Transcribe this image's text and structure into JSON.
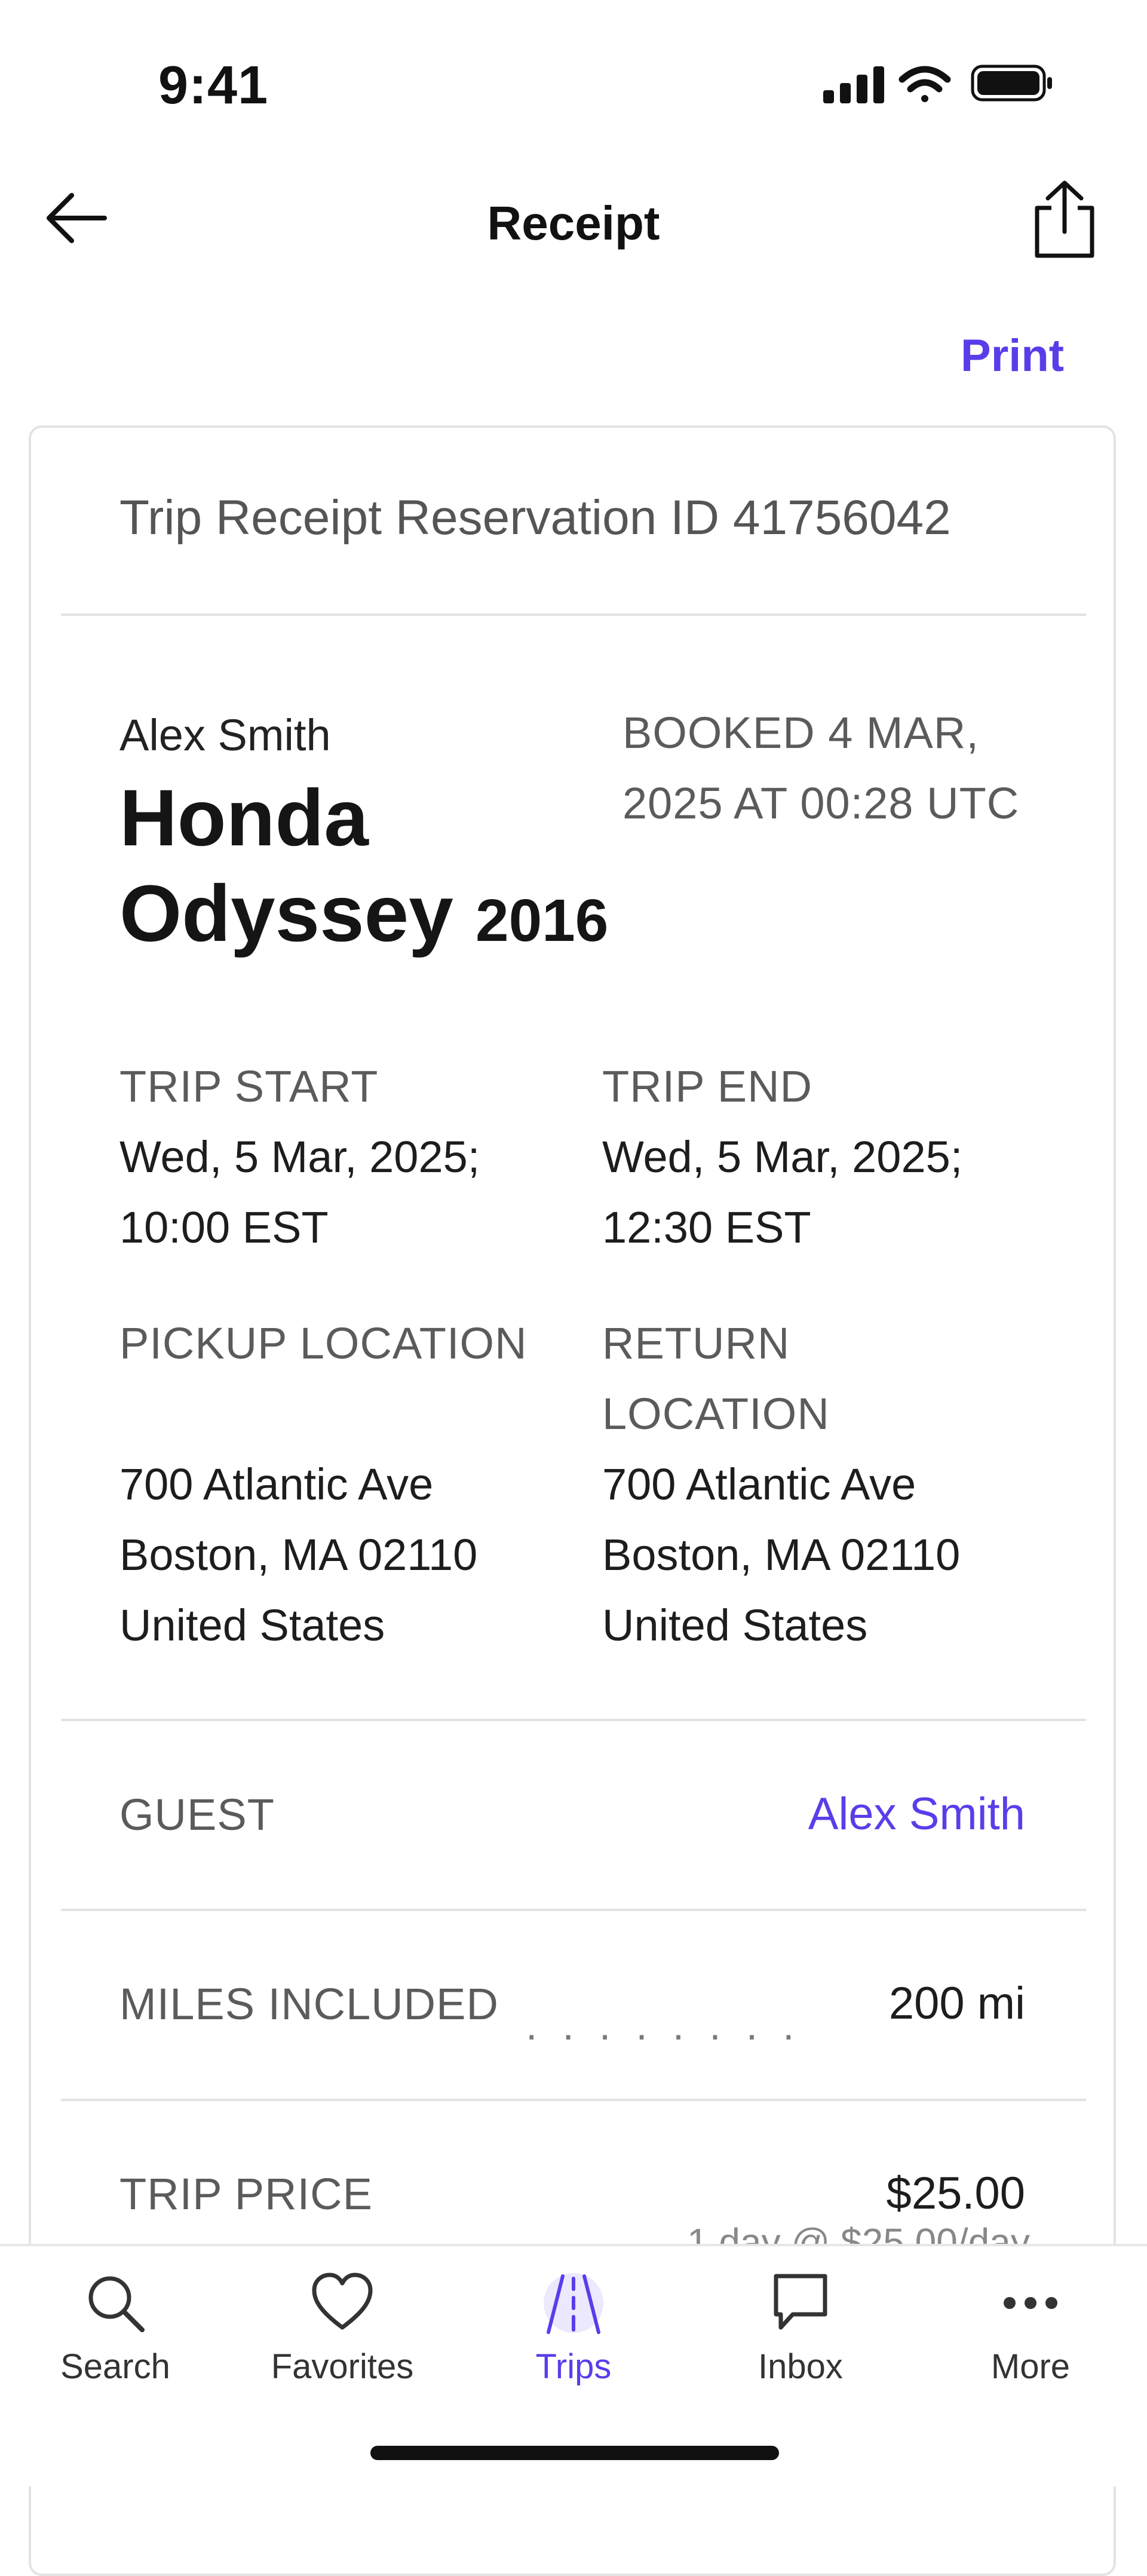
{
  "status_bar": {
    "time": "9:41"
  },
  "header": {
    "title": "Receipt",
    "print_label": "Print"
  },
  "receipt": {
    "heading": "Trip Receipt Reservation ID 41756042",
    "owner_name": "Alex Smith",
    "car_name": "Honda Odyssey",
    "car_year": "2016",
    "booked": "BOOKED 4 MAR, 2025 AT 00:28 UTC",
    "trip_start": {
      "label": "TRIP START",
      "value": "Wed, 5 Mar, 2025; 10:00 EST"
    },
    "trip_end": {
      "label": "TRIP END",
      "value": "Wed, 5 Mar, 2025; 12:30 EST"
    },
    "pickup": {
      "label": "PICKUP LOCATION",
      "line1": "700 Atlantic Ave",
      "line2": "Boston, MA 02110",
      "line3": "United States"
    },
    "return": {
      "label": "RETURN LOCATION",
      "line1": "700 Atlantic Ave",
      "line2": "Boston, MA 02110",
      "line3": "United States"
    },
    "guest": {
      "label": "GUEST",
      "value": "Alex Smith"
    },
    "miles": {
      "label": "MILES INCLUDED",
      "value": "200 mi"
    },
    "trip_price": {
      "label": "TRIP PRICE",
      "value": "$25.00",
      "detail": "1 day @ $25.00/day"
    }
  },
  "tabs": [
    {
      "label": "Search",
      "icon": "search-icon"
    },
    {
      "label": "Favorites",
      "icon": "heart-icon"
    },
    {
      "label": "Trips",
      "icon": "trips-road-icon",
      "active": true
    },
    {
      "label": "Inbox",
      "icon": "chat-bubble-icon"
    },
    {
      "label": "More",
      "icon": "more-dots-icon"
    }
  ],
  "colors": {
    "accent": "#5a3dea",
    "divider": "#e2e2e2",
    "muted_text": "#5b5b5b"
  }
}
